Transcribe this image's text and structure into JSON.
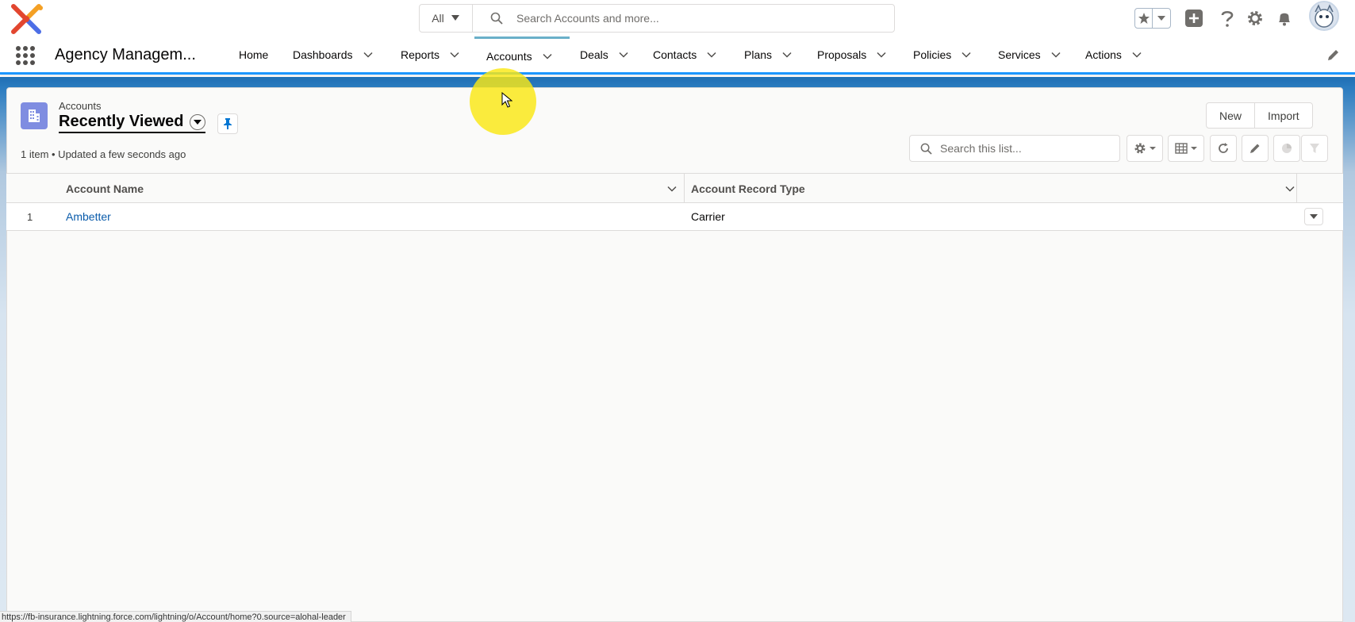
{
  "header": {
    "search_scope": "All",
    "search_placeholder": "Search Accounts and more...",
    "icons": [
      "favorites-star-icon",
      "add-icon",
      "help-icon",
      "setup-gear-icon",
      "notifications-bell-icon",
      "avatar"
    ]
  },
  "nav": {
    "app_name": "Agency Managem...",
    "items": [
      {
        "label": "Home",
        "has_menu": false
      },
      {
        "label": "Dashboards",
        "has_menu": true
      },
      {
        "label": "Reports",
        "has_menu": true
      },
      {
        "label": "Accounts",
        "has_menu": true,
        "active": true
      },
      {
        "label": "Deals",
        "has_menu": true
      },
      {
        "label": "Contacts",
        "has_menu": true
      },
      {
        "label": "Plans",
        "has_menu": true
      },
      {
        "label": "Proposals",
        "has_menu": true
      },
      {
        "label": "Policies",
        "has_menu": true
      },
      {
        "label": "Services",
        "has_menu": true
      },
      {
        "label": "Actions",
        "has_menu": true
      }
    ]
  },
  "list_view": {
    "object_label": "Accounts",
    "title": "Recently Viewed",
    "meta": "1 item • Updated a few seconds ago",
    "buttons": {
      "new": "New",
      "import": "Import"
    },
    "search_placeholder": "Search this list...",
    "columns": [
      "Account Name",
      "Account Record Type"
    ],
    "rows": [
      {
        "num": "1",
        "account_name": "Ambetter",
        "record_type": "Carrier"
      }
    ]
  },
  "status_bar": {
    "url": "https://fb-insurance.lightning.force.com/lightning/o/Account/home?0.source=alohal-leader"
  },
  "colors": {
    "accent_blue": "#1b96ff",
    "link_blue": "#0b5cab",
    "account_icon": "#7f8de1",
    "cursor_highlight": "#fae814"
  }
}
